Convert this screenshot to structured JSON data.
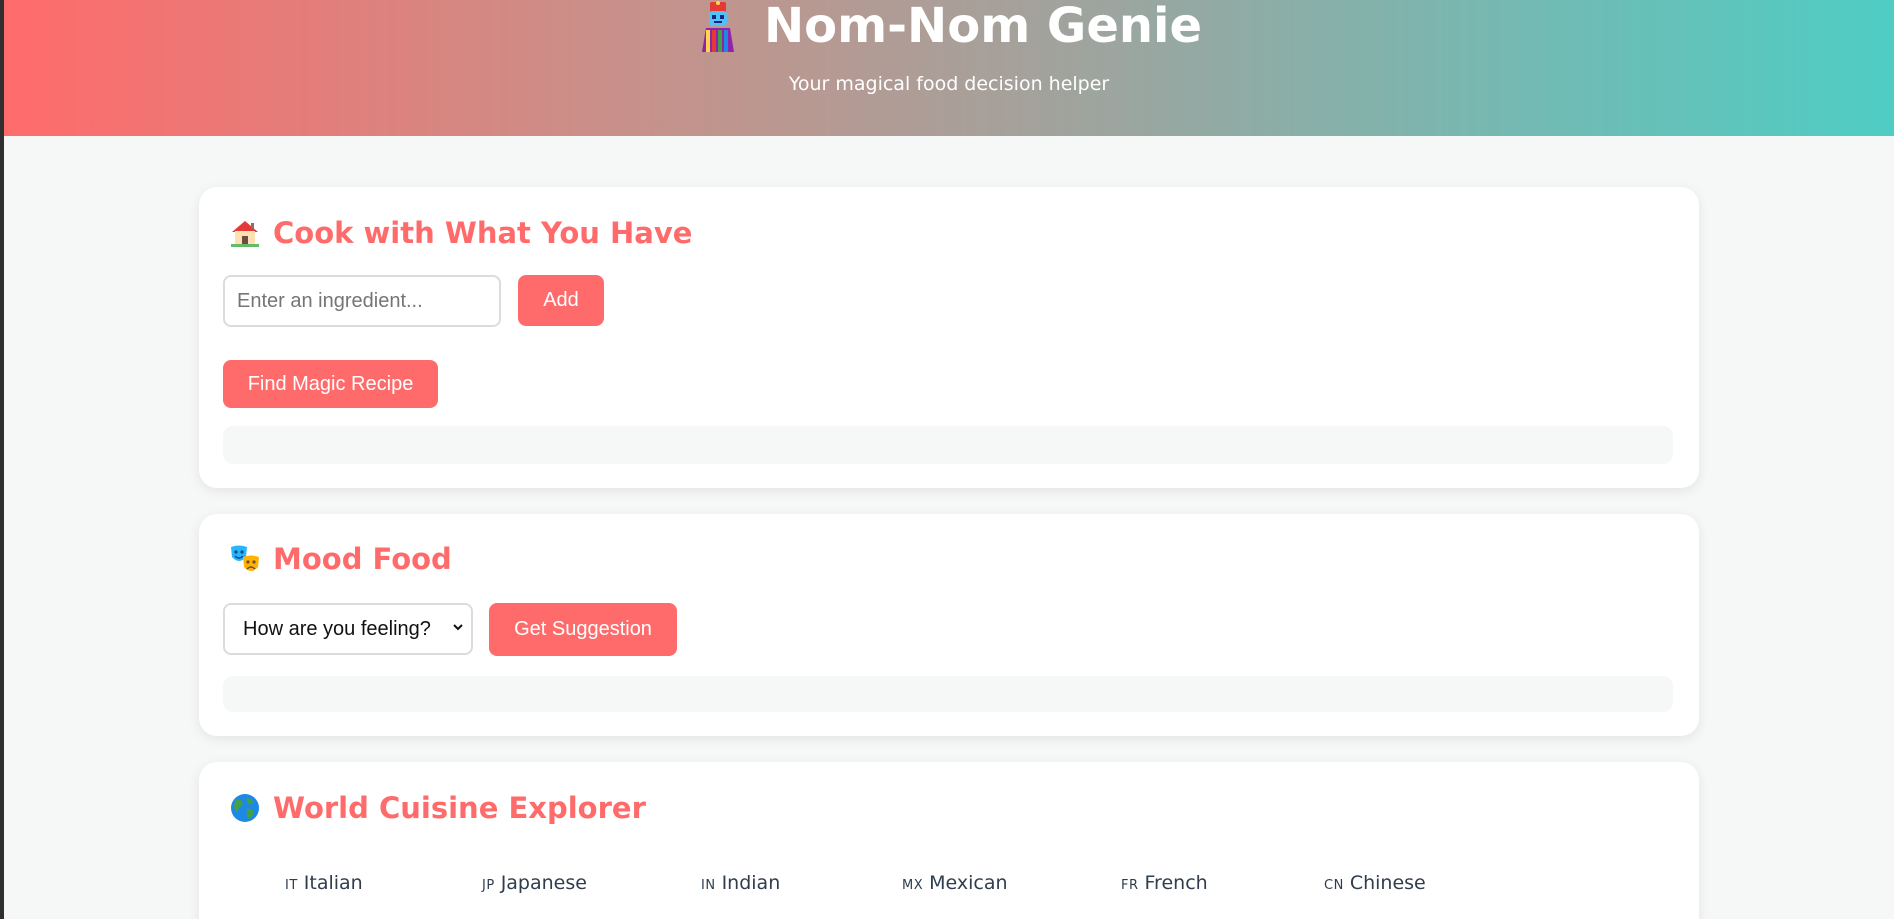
{
  "header": {
    "title": "Nom-Nom Genie",
    "subtitle": "Your magical food decision helper",
    "icon": "genie-icon",
    "gradient_start": "#ff6b6b",
    "gradient_end": "#4ecdc4"
  },
  "accent_color": "#ff6b6b",
  "ingredients_card": {
    "icon": "house-icon",
    "title": "Cook with What You Have",
    "input_placeholder": "Enter an ingredient...",
    "input_value": "",
    "add_label": "Add",
    "find_label": "Find Magic Recipe",
    "result_text": ""
  },
  "mood_card": {
    "icon": "theater-masks-icon",
    "title": "Mood Food",
    "select_value": "How are you feeling?",
    "suggest_label": "Get Suggestion",
    "result_text": ""
  },
  "cuisine_card": {
    "icon": "globe-icon",
    "title": "World Cuisine Explorer",
    "cuisines": [
      {
        "code": "IT",
        "name": "Italian"
      },
      {
        "code": "JP",
        "name": "Japanese"
      },
      {
        "code": "IN",
        "name": "Indian"
      },
      {
        "code": "MX",
        "name": "Mexican"
      },
      {
        "code": "FR",
        "name": "French"
      },
      {
        "code": "CN",
        "name": "Chinese"
      }
    ]
  }
}
